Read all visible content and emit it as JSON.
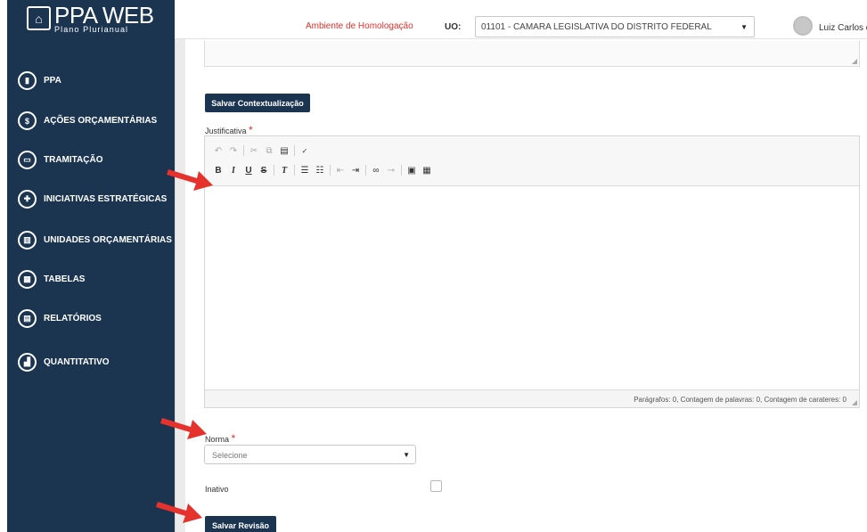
{
  "app": {
    "logo_mark": "PPA",
    "title": "PPA WEB",
    "subtitle": "Plano Plurianual"
  },
  "sidebar": {
    "items": [
      {
        "label": "PPA",
        "icon": "book-icon",
        "glyph": "▮"
      },
      {
        "label": "AÇÕES ORÇAMENTÁRIAS",
        "icon": "dollar-icon",
        "glyph": "$"
      },
      {
        "label": "TRAMITAÇÃO",
        "icon": "inbox-icon",
        "glyph": "▭"
      },
      {
        "label": "INICIATIVAS ESTRATÉGICAS",
        "icon": "puzzle-icon",
        "glyph": "✚"
      },
      {
        "label": "UNIDADES ORÇAMENTÁRIAS",
        "icon": "bank-icon",
        "glyph": "▥"
      },
      {
        "label": "TABELAS",
        "icon": "table-icon",
        "glyph": "▦"
      },
      {
        "label": "RELATÓRIOS",
        "icon": "document-icon",
        "glyph": "▤"
      },
      {
        "label": "QUANTITATIVO",
        "icon": "bar-chart-icon",
        "glyph": "▟"
      }
    ]
  },
  "header": {
    "environment": "Ambiente de Homologação",
    "uo_label": "UO:",
    "uo_value": "01101 - CAMARA LEGISLATIVA DO DISTRITO FEDERAL",
    "user_name": "Luiz Carlos de"
  },
  "form": {
    "save_context_button": "Salvar Contextualização",
    "justificativa_label": "Justificativa",
    "required_mark": "*",
    "editor_status": "Parágrafos: 0, Contagem de palavras: 0, Contagem de carateres: 0",
    "norma_label": "Norma",
    "norma_placeholder": "Selecione",
    "inativo_label": "Inativo",
    "save_review_button": "Salvar Revisão"
  },
  "toolbar": {
    "row1": [
      "undo-icon",
      "redo-icon",
      "cut-icon",
      "copy-icon",
      "paste-icon",
      "spellcheck-icon"
    ],
    "row2": [
      "bold-icon",
      "italic-icon",
      "underline-icon",
      "strikethrough-icon",
      "clear-format-icon",
      "ordered-list-icon",
      "unordered-list-icon",
      "outdent-icon",
      "indent-icon",
      "link-icon",
      "unlink-icon",
      "image-icon",
      "table-icon"
    ]
  },
  "colors": {
    "sidebar_bg": "#1b3551",
    "button_bg": "#1b3551",
    "environment_text": "#e0302b",
    "annotation_arrow": "#e5322d"
  }
}
